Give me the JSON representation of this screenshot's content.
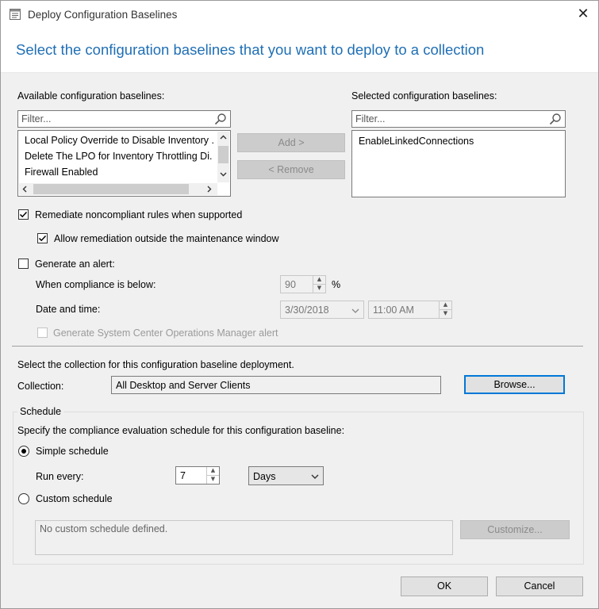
{
  "window": {
    "title": "Deploy Configuration Baselines",
    "close_glyph": "✕"
  },
  "heading": "Select the configuration baselines that you want to deploy to a collection",
  "available": {
    "label": "Available configuration baselines:",
    "filter_placeholder": "Filter...",
    "items": [
      "Local Policy Override to Disable Inventory .",
      "Delete The LPO for Inventory Throttling Di.",
      "Firewall Enabled"
    ],
    "scroll_left": "<",
    "scroll_right": ">",
    "scroll_up": "^",
    "scroll_down": "v"
  },
  "selected": {
    "label": "Selected configuration baselines:",
    "filter_placeholder": "Filter...",
    "items": [
      "EnableLinkedConnections"
    ]
  },
  "buttons": {
    "add": "Add >",
    "remove": "< Remove",
    "browse": "Browse...",
    "customize": "Customize...",
    "ok": "OK",
    "cancel": "Cancel"
  },
  "options": {
    "remediate": {
      "label": "Remediate noncompliant rules when supported",
      "checked": true
    },
    "allow_outside": {
      "label": "Allow remediation outside the maintenance window",
      "checked": true
    },
    "generate_alert": {
      "label": "Generate an alert:",
      "checked": false
    },
    "compliance_label": "When compliance is below:",
    "compliance_value": "90",
    "compliance_unit": "%",
    "datetime_label": "Date and time:",
    "date_value": "3/30/2018",
    "time_value": "11:00 AM",
    "scom_alert": {
      "label": "Generate System Center Operations Manager alert",
      "checked": false
    }
  },
  "collection": {
    "intro": "Select the collection for this configuration baseline deployment.",
    "label": "Collection:",
    "value": "All Desktop and Server Clients"
  },
  "schedule": {
    "group_title": "Schedule",
    "description": "Specify the compliance evaluation schedule for this configuration baseline:",
    "simple_label": "Simple schedule",
    "run_every_label": "Run every:",
    "run_every_value": "7",
    "unit": "Days",
    "custom_label": "Custom schedule",
    "custom_placeholder": "No custom schedule defined.",
    "selected": "simple"
  },
  "colors": {
    "heading": "#1f6fb5",
    "focus": "#0078d7"
  }
}
